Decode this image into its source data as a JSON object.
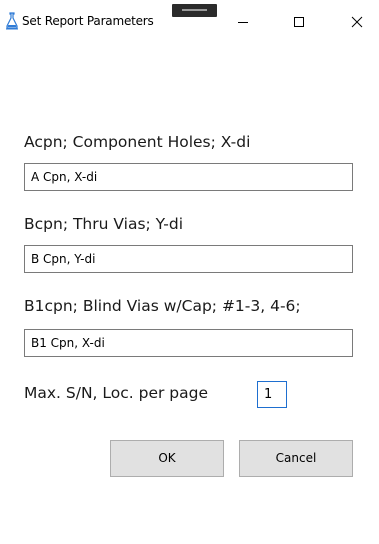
{
  "window": {
    "title": "Set Report Parameters"
  },
  "fields": {
    "acpn": {
      "label": "Acpn; Component Holes; X-di",
      "value": "A Cpn, X-di"
    },
    "bcpn": {
      "label": "Bcpn; Thru Vias; Y-di",
      "value": "B Cpn, Y-di"
    },
    "b1cpn": {
      "label": "B1cpn; Blind Vias w/Cap; #1-3, 4-6;",
      "value": "B1 Cpn, X-di"
    },
    "max_sn": {
      "label": "Max. S/N, Loc. per page",
      "value": "1"
    }
  },
  "buttons": {
    "ok_label": "OK",
    "cancel_label": "Cancel"
  },
  "icons": {
    "app": "flask-icon",
    "minimize": "minimize-icon",
    "maximize": "maximize-icon",
    "close": "close-icon"
  },
  "colors": {
    "accent_focus": "#1e6fd0",
    "button_face": "#e1e1e1",
    "app_icon": "#2f7bd6"
  }
}
